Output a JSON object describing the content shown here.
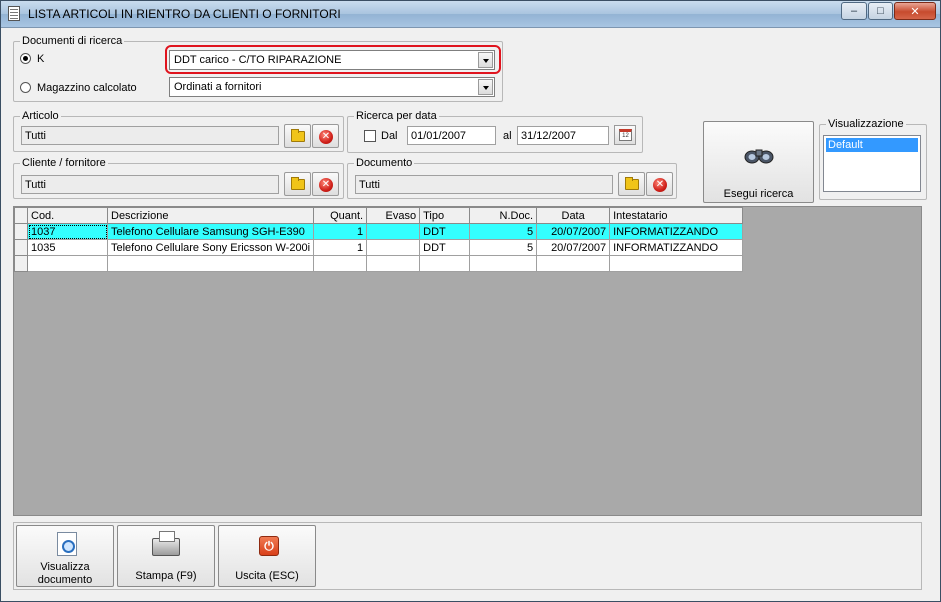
{
  "window": {
    "title": "LISTA ARTICOLI IN RIENTRO DA CLIENTI O FORNITORI",
    "minimize": "–",
    "maximize": "□",
    "close": "✕"
  },
  "documenti": {
    "group_label": "Documenti di ricerca",
    "radio_k_label": "K",
    "radio_magazzino_label": "Magazzino calcolato",
    "combo_doc_value": "DDT carico - C/TO RIPARAZIONE",
    "combo_magazzino_value": "Ordinati a fornitori"
  },
  "articolo": {
    "label": "Articolo",
    "value": "Tutti"
  },
  "ricerca_data": {
    "label": "Ricerca per data",
    "dal_label": "Dal",
    "dal_value": "01/01/2007",
    "al_label": "al",
    "al_value": "31/12/2007",
    "calendar_text": "12"
  },
  "cliente": {
    "label": "Cliente / fornitore",
    "value": "Tutti"
  },
  "documento": {
    "label": "Documento",
    "value": "Tutti"
  },
  "esegui_label": "Esegui ricerca",
  "visualizzazione": {
    "label": "Visualizzazione",
    "selected": "Default"
  },
  "grid": {
    "columns": [
      "Cod.",
      "Descrizione",
      "Quant.",
      "Evaso",
      "Tipo",
      "N.Doc.",
      "Data",
      "Intestatario"
    ],
    "rows": [
      [
        "1037",
        "Telefono Cellulare Samsung SGH-E390",
        "1",
        "",
        "DDT",
        "5",
        "20/07/2007",
        "INFORMATIZZANDO"
      ],
      [
        "1035",
        "Telefono Cellulare Sony Ericsson W-200i",
        "1",
        "",
        "DDT",
        "5",
        "20/07/2007",
        "INFORMATIZZANDO"
      ]
    ]
  },
  "buttons": {
    "visualizza": "Visualizza documento",
    "stampa": "Stampa (F9)",
    "uscita": "Uscita (ESC)"
  },
  "colors": {
    "highlight_border": "#e0141e",
    "active_row": "#33ffff",
    "list_selection": "#3399ff"
  }
}
